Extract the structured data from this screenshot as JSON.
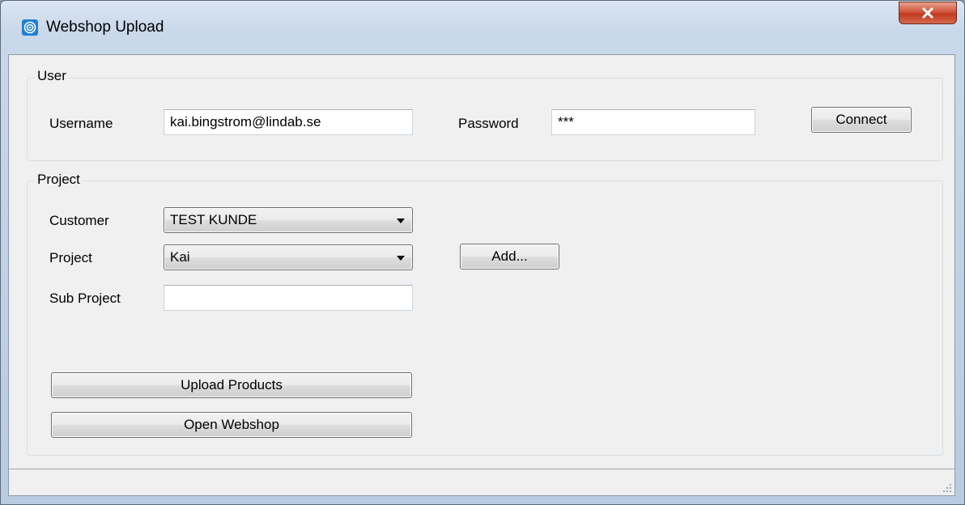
{
  "window": {
    "title": "Webshop Upload",
    "app_icon": "webshop-app-icon",
    "close_label": "x"
  },
  "user_group": {
    "label": "User",
    "username_label": "Username",
    "username_value": "kai.bingstrom@lindab.se",
    "password_label": "Password",
    "password_value": "***",
    "connect_label": "Connect"
  },
  "project_group": {
    "label": "Project",
    "customer_label": "Customer",
    "customer_value": "TEST KUNDE",
    "project_label": "Project",
    "project_value": "Kai",
    "add_label": "Add...",
    "subproject_label": "Sub Project",
    "subproject_value": "",
    "upload_label": "Upload Products",
    "open_webshop_label": "Open Webshop"
  },
  "colors": {
    "close_button": "#c9462c",
    "app_icon": "#1f7fd4",
    "client_background": "#f0f0f0"
  }
}
